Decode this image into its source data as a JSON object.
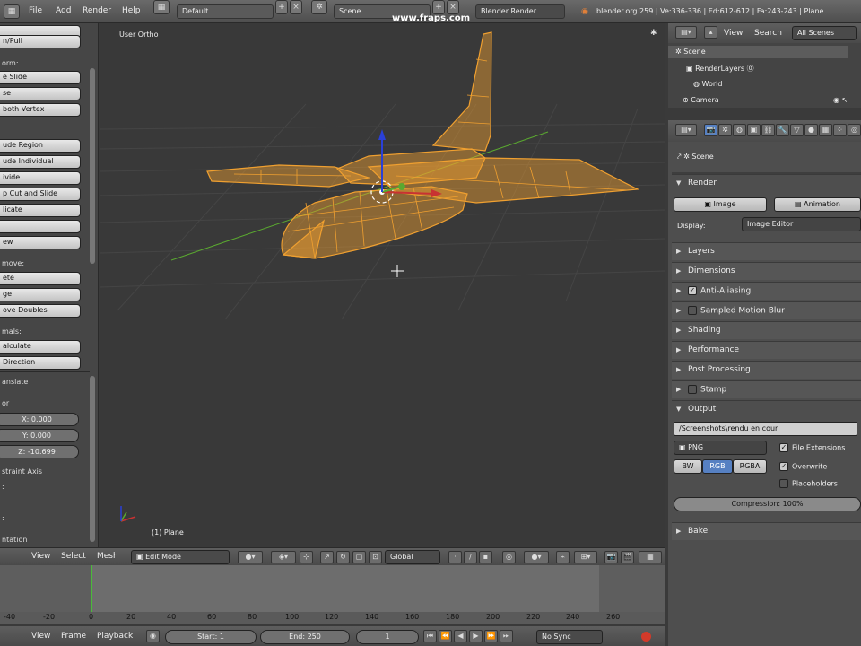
{
  "top_bar": {
    "menus": [
      "File",
      "Add",
      "Render",
      "Help"
    ],
    "screen_layout": "Default",
    "scene": "Scene",
    "render_engine": "Blender Render",
    "stats": "blender.org 259 | Ve:336-336 | Ed:612-612 | Fa:243-243 | Plane",
    "watermark": "www.fraps.com"
  },
  "toolshelf": {
    "buttons_top": [
      "n/Pull"
    ],
    "remove_label": "orm:",
    "transform_buttons": [
      "e Slide",
      "se",
      "both Vertex"
    ],
    "extrude_buttons": [
      "ude Region",
      "ude Individual",
      "ivide",
      "p Cut and Slide",
      "licate",
      "",
      "ew"
    ],
    "remove_section": "move:",
    "remove_buttons": [
      "ete",
      "ge",
      "ove Doubles"
    ],
    "normals_section": "mals:",
    "normals_buttons": [
      "alculate",
      "Direction"
    ],
    "operator_title": "anslate",
    "vector_label": "or",
    "x": "X: 0.000",
    "y": "Y: 0.000",
    "z": "Z: -10.699",
    "constraint": "straint Axis",
    "orientation": "ntation"
  },
  "viewport": {
    "view_label": "User Ortho",
    "object_label": "(1) Plane"
  },
  "header3d": {
    "menus": [
      "View",
      "Select",
      "Mesh"
    ],
    "mode": "Edit Mode",
    "orientation": "Global"
  },
  "timeline": {
    "ticks": [
      "-40",
      "-20",
      "0",
      "20",
      "40",
      "60",
      "80",
      "100",
      "120",
      "140",
      "160",
      "180",
      "200",
      "220",
      "240",
      "260"
    ],
    "menus": [
      "View",
      "Frame",
      "Playback"
    ],
    "start": "Start: 1",
    "end": "End: 250",
    "current": "1",
    "sync": "No Sync"
  },
  "outliner": {
    "menus": [
      "View",
      "Search"
    ],
    "filter": "All Scenes",
    "items": [
      "Scene",
      "RenderLayers",
      "World",
      "Camera"
    ]
  },
  "properties": {
    "scene_name": "Scene",
    "render_panel": "Render",
    "image_button": "Image",
    "animation_button": "Animation",
    "display_label": "Display:",
    "display_value": "Image Editor",
    "panels": [
      "Layers",
      "Dimensions",
      "Anti-Aliasing",
      "Sampled Motion Blur",
      "Shading",
      "Performance",
      "Post Processing",
      "Stamp"
    ],
    "output_panel": "Output",
    "output_path": "/Screenshots\\rendu en cour",
    "file_format": "PNG",
    "color_modes": [
      "BW",
      "RGB",
      "RGBA"
    ],
    "file_extensions": "File Extensions",
    "overwrite": "Overwrite",
    "placeholders": "Placeholders",
    "compression": "Compression: 100%",
    "bake_panel": "Bake"
  },
  "colors": {
    "mesh": "#f0a030",
    "accent": "#5680c2",
    "x_axis": "#c83232",
    "y_axis": "#5aa830",
    "z_axis": "#2a40d8"
  }
}
